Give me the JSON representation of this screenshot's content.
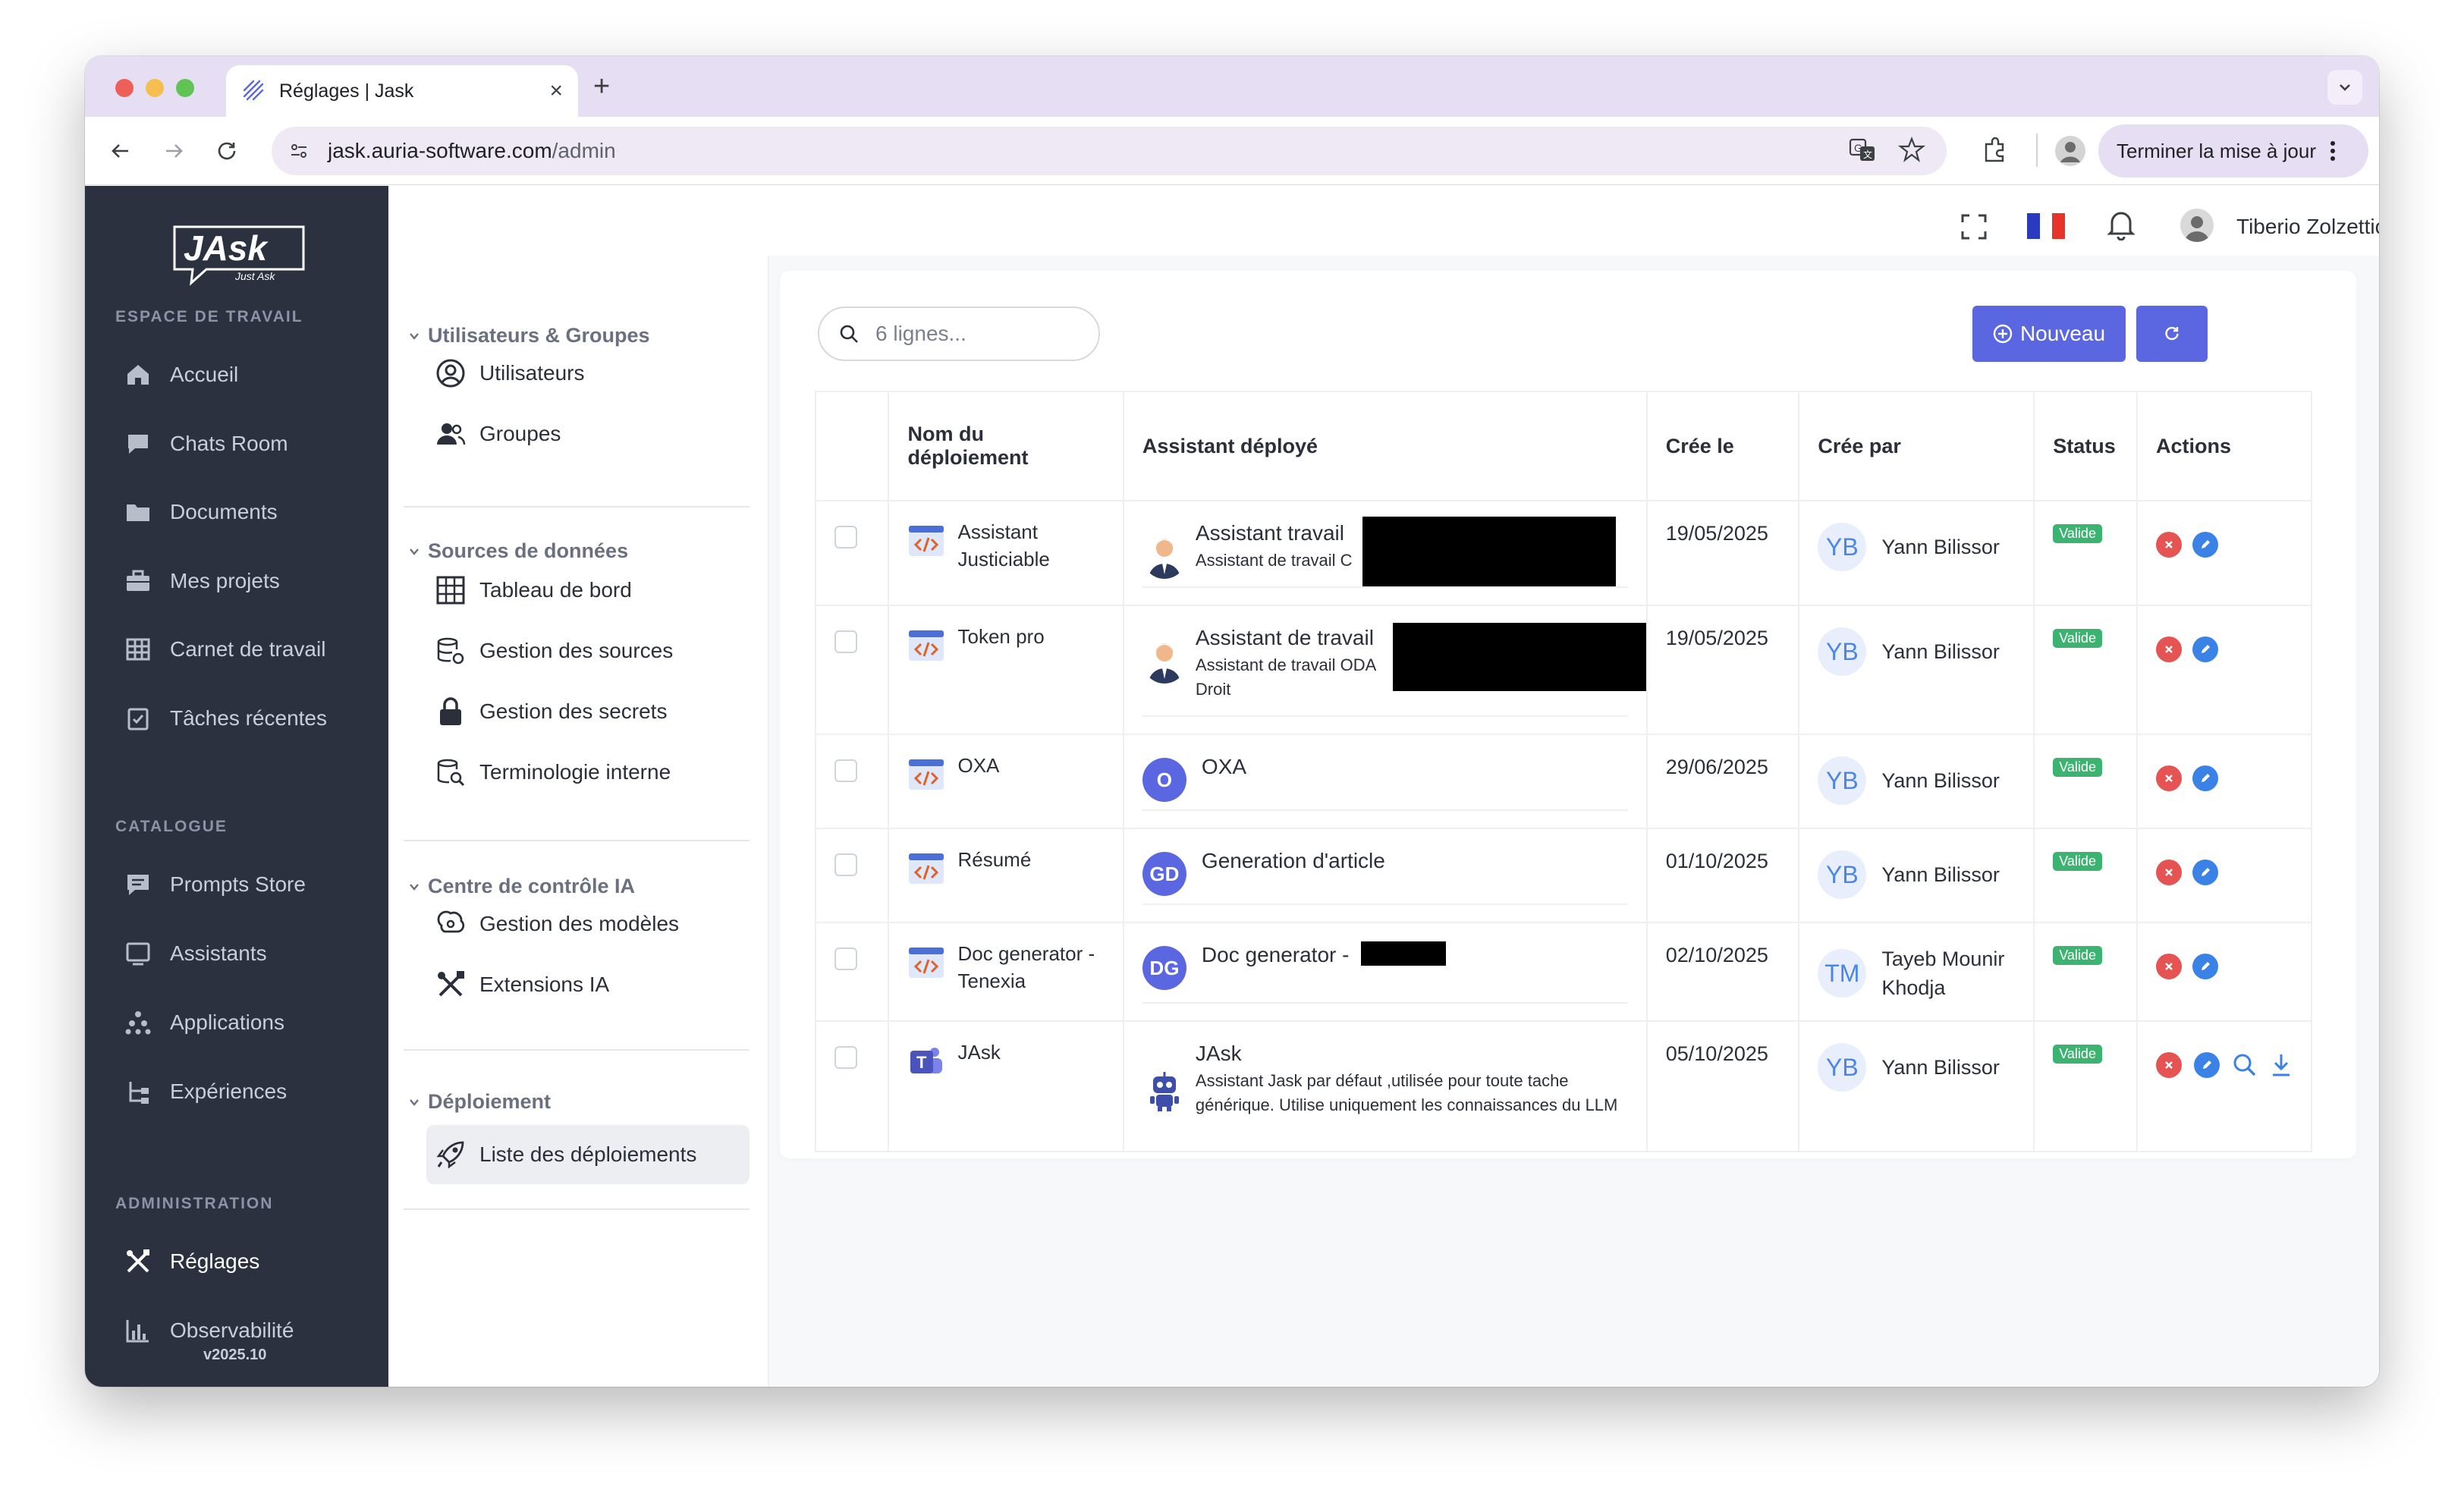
{
  "browser": {
    "tab_title": "Réglages | Jask",
    "url_host": "jask.auria-software.com",
    "url_path": "/admin",
    "update_button": "Terminer la mise à jour"
  },
  "sidebar": {
    "logo_text": "JAsk",
    "logo_tagline": "Just Ask",
    "sections": {
      "workspace": "ESPACE DE TRAVAIL",
      "catalog": "CATALOGUE",
      "admin": "ADMINISTRATION"
    },
    "items": [
      {
        "label": "Accueil",
        "icon": "home-icon"
      },
      {
        "label": "Chats Room",
        "icon": "chat-icon"
      },
      {
        "label": "Documents",
        "icon": "folder-icon"
      },
      {
        "label": "Mes projets",
        "icon": "briefcase-icon"
      },
      {
        "label": "Carnet de travail",
        "icon": "grid-icon"
      },
      {
        "label": "Tâches récentes",
        "icon": "task-icon"
      },
      {
        "label": "Prompts Store",
        "icon": "message-icon"
      },
      {
        "label": "Assistants",
        "icon": "monitor-icon"
      },
      {
        "label": "Applications",
        "icon": "apps-icon"
      },
      {
        "label": "Expériences",
        "icon": "tree-icon"
      },
      {
        "label": "Réglages",
        "icon": "tools-icon"
      },
      {
        "label": "Observabilité",
        "icon": "bar-chart-icon"
      }
    ],
    "version": "v2025.10"
  },
  "header": {
    "user_name": "Tiberio Zolzettich"
  },
  "settings_nav": {
    "groups": [
      {
        "title": "Utilisateurs & Groupes",
        "items": [
          "Utilisateurs",
          "Groupes"
        ]
      },
      {
        "title": "Sources de données",
        "items": [
          "Tableau de bord",
          "Gestion des sources",
          "Gestion des secrets",
          "Terminologie interne"
        ]
      },
      {
        "title": "Centre de contrôle IA",
        "items": [
          "Gestion des modèles",
          "Extensions IA"
        ]
      },
      {
        "title": "Déploiement",
        "items": [
          "Liste des déploiements"
        ]
      }
    ],
    "active_item": "Liste des déploiements"
  },
  "toolbar": {
    "search_placeholder": "6 lignes...",
    "new_button": "Nouveau"
  },
  "table": {
    "columns": [
      "Nom du déploiement",
      "Assistant déployé",
      "Crée le",
      "Crée par",
      "Status",
      "Actions"
    ],
    "rows": [
      {
        "name": "Assistant Justiciable",
        "assistant_title": "Assistant travail",
        "assistant_desc": "Assistant de travail C",
        "assistant_avatar": "person",
        "date": "19/05/2025",
        "creator_initials": "YB",
        "creator": "Yann Bilissor",
        "status": "Valide"
      },
      {
        "name": "Token pro",
        "assistant_title": "Assistant de travail",
        "assistant_desc": "Assistant de travail ODA Droit",
        "assistant_avatar": "person",
        "date": "19/05/2025",
        "creator_initials": "YB",
        "creator": "Yann Bilissor",
        "status": "Valide"
      },
      {
        "name": "OXA",
        "assistant_title": "OXA",
        "assistant_desc": "",
        "assistant_avatar": "O",
        "date": "29/06/2025",
        "creator_initials": "YB",
        "creator": "Yann Bilissor",
        "status": "Valide"
      },
      {
        "name": "Résumé",
        "assistant_title": "Generation d'article",
        "assistant_desc": "",
        "assistant_avatar": "GD",
        "date": "01/10/2025",
        "creator_initials": "YB",
        "creator": "Yann Bilissor",
        "status": "Valide"
      },
      {
        "name": "Doc generator - Tenexia",
        "assistant_title": "Doc generator -",
        "assistant_desc": "",
        "assistant_avatar": "DG",
        "date": "02/10/2025",
        "creator_initials": "TM",
        "creator": "Tayeb Mounir Khodja",
        "status": "Valide"
      },
      {
        "name": "JAsk",
        "assistant_title": "JAsk",
        "assistant_desc": "Assistant Jask par défaut ,utilisée pour toute tache générique. Utilise uniquement les connaissances du LLM",
        "assistant_avatar": "robot",
        "date": "05/10/2025",
        "creator_initials": "YB",
        "creator": "Yann Bilissor",
        "status": "Valide"
      }
    ]
  },
  "colors": {
    "sidebar_bg": "#2c3140",
    "accent": "#5a67e0",
    "status_green": "#3cb371",
    "delete_red": "#e55353",
    "edit_blue": "#3b82e6"
  }
}
